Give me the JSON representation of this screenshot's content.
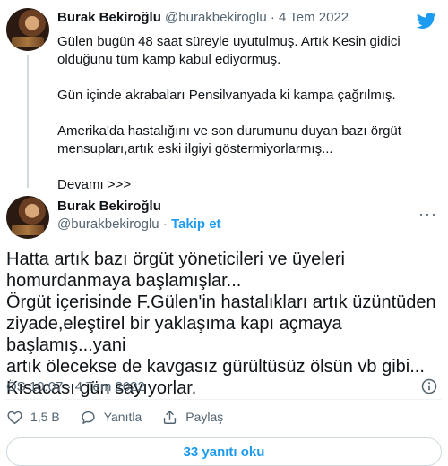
{
  "tweet1": {
    "author_name": "Burak Bekiroğlu",
    "handle": "@burakbekiroglu",
    "separator": "·",
    "date": "4 Tem 2022",
    "lines": [
      "Gülen bugün 48 saat süreyle uyutulmuş. Artık Kesin gidici olduğunu tüm kamp kabul ediyormuş.",
      "Gün içinde akrabaları Pensilvanyada ki kampa çağrılmış.",
      "Amerika'da hastalığını ve son durumunu duyan bazı örgüt mensupları,artık eski ilgiyi göstermiyorlarmış...",
      "Devamı >>>"
    ]
  },
  "tweet2": {
    "author_name": "Burak Bekiroğlu",
    "handle": "@burakbekiroglu",
    "separator": "·",
    "follow_label": "Takip et",
    "more_label": "···",
    "text_lines": [
      "Hatta artık bazı örgüt yöneticileri ve üyeleri",
      "homurdanmaya başlamışlar...",
      "Örgüt içerisinde F.Gülen'in hastalıkları artık üzüntüden",
      "ziyade,eleştirel bir yaklaşıma kapı açmaya başlamış...yani",
      "artık ölecekse de kavgasız gürültüsüz ölsün vb gibi...",
      "Kısacası gün sayıyorlar."
    ],
    "time": "ÖS 10:07",
    "date": "4 Tem 2022"
  },
  "actions": {
    "like_count": "1,5 B",
    "reply_label": "Yanıtla",
    "share_label": "Paylaş"
  },
  "read_replies_label": "33 yanıtı oku",
  "colors": {
    "accent": "#1d9bf0",
    "muted": "#536471",
    "text": "#0f1419"
  },
  "icons": [
    "twitter-bird-icon",
    "info-icon",
    "heart-icon",
    "reply-bubble-icon",
    "share-icon"
  ]
}
